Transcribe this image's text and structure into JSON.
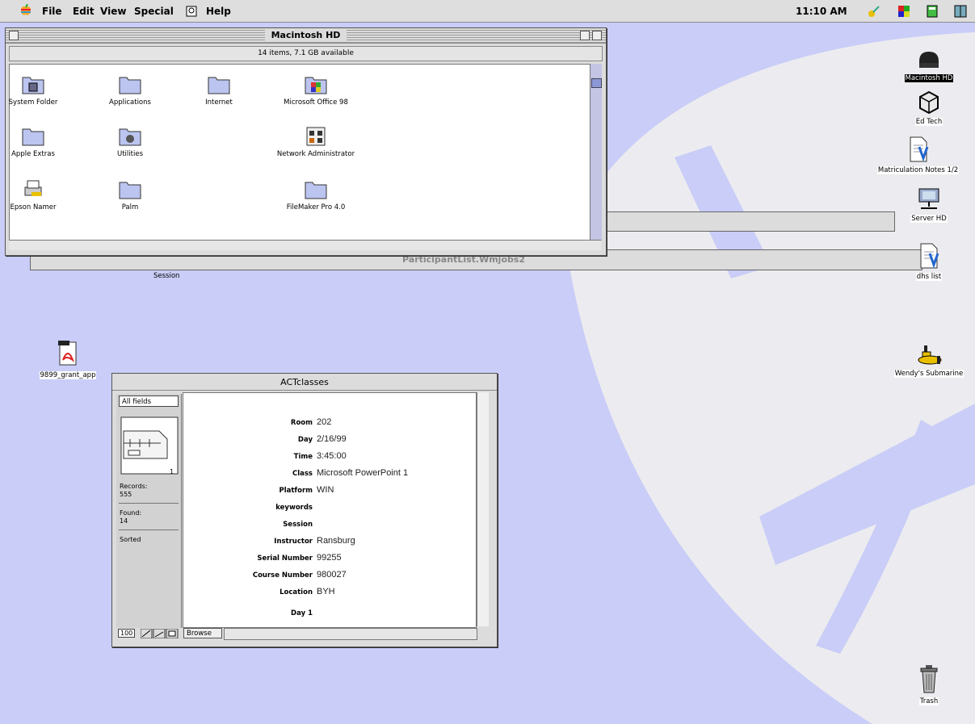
{
  "menubar": {
    "items": [
      "File",
      "Edit",
      "View",
      "Special",
      "Help"
    ],
    "clock": "11:10 AM"
  },
  "finder": {
    "title": "Macintosh HD",
    "info": "14 items, 7.1 GB available",
    "icons": [
      {
        "label": "System Folder",
        "icon": "system-folder-icon"
      },
      {
        "label": "Applications",
        "icon": "folder-icon"
      },
      {
        "label": "Internet",
        "icon": "folder-icon"
      },
      {
        "label": "Microsoft Office 98",
        "icon": "office-folder-icon"
      },
      {
        "label": "Apple Extras",
        "icon": "folder-icon"
      },
      {
        "label": "Utilities",
        "icon": "utilities-folder-icon"
      },
      {
        "label": "Network Administrator",
        "icon": "network-admin-icon"
      },
      {
        "label": "Epson Namer",
        "icon": "printer-icon"
      },
      {
        "label": "Palm",
        "icon": "folder-icon"
      },
      {
        "label": "FileMaker Pro 4.0",
        "icon": "folder-icon"
      }
    ]
  },
  "background_windows": {
    "title": "ParticipantList.Wmjobs2",
    "session_label": "Session"
  },
  "filemaker": {
    "title": "ACTclasses",
    "layout_menu": "All fields",
    "book_page": "1",
    "records_label": "Records:",
    "records_value": "555",
    "found_label": "Found:",
    "found_value": "14",
    "sorted_label": "Sorted",
    "zoom": "100",
    "mode": "Browse",
    "fields": [
      {
        "label": "Room",
        "value": "202"
      },
      {
        "label": "Day",
        "value": "2/16/99"
      },
      {
        "label": "Time",
        "value": "3:45:00"
      },
      {
        "label": "Class",
        "value": "Microsoft PowerPoint 1"
      },
      {
        "label": "Platform",
        "value": "WIN"
      },
      {
        "label": "keywords",
        "value": ""
      },
      {
        "label": "Session",
        "value": ""
      },
      {
        "label": "Instructor",
        "value": "Ransburg"
      },
      {
        "label": "Serial Number",
        "value": "99255"
      },
      {
        "label": "Course Number",
        "value": "980027"
      },
      {
        "label": "Location",
        "value": "BYH"
      },
      {
        "label": "Day 1",
        "value": ""
      }
    ]
  },
  "desktop_icons": [
    {
      "label": "Macintosh HD",
      "icon": "hard-drive-icon",
      "selected": true
    },
    {
      "label": "Ed Tech",
      "icon": "server-icon",
      "selected": false
    },
    {
      "label": "Matriculation Notes 1/2",
      "icon": "document-icon",
      "selected": false
    },
    {
      "label": "Server HD",
      "icon": "network-drive-icon",
      "selected": false
    },
    {
      "label": "dhs list",
      "icon": "document-icon",
      "selected": false
    },
    {
      "label": "9899_grant_app",
      "icon": "pdf-icon",
      "selected": false
    },
    {
      "label": "Wendy's Submarine",
      "icon": "submarine-icon",
      "selected": false
    },
    {
      "label": "Trash",
      "icon": "trash-icon",
      "selected": false
    }
  ]
}
